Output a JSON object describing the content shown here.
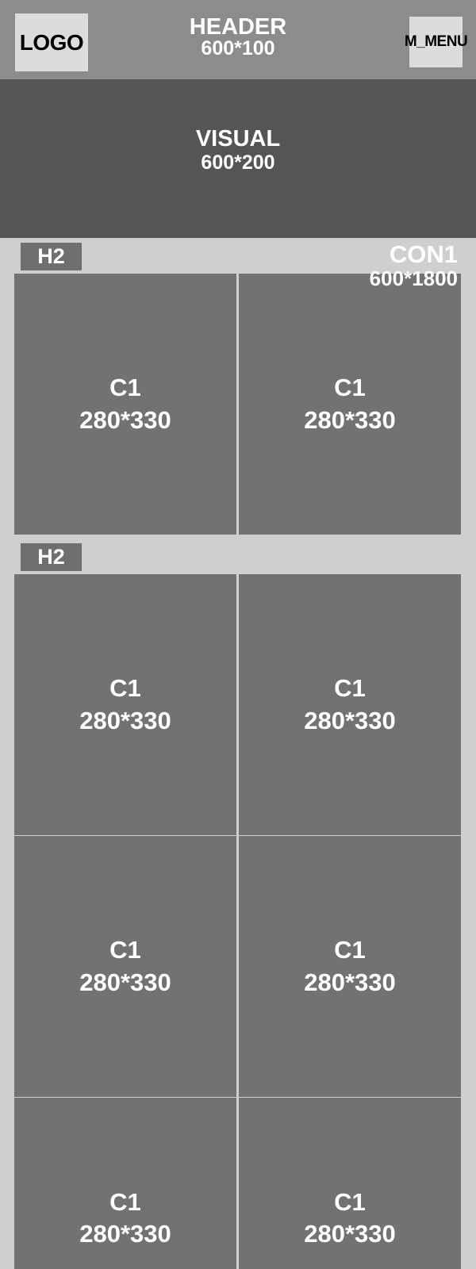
{
  "header": {
    "logo": "LOGO",
    "title": "HEADER",
    "size": "600*100",
    "menu": "M_MENU"
  },
  "visual": {
    "title": "VISUAL",
    "size": "600*200"
  },
  "con1": {
    "title": "CON1",
    "size": "600*1800"
  },
  "sections": [
    {
      "heading": "H2",
      "cards": [
        {
          "title": "C1",
          "size": "280*330"
        },
        {
          "title": "C1",
          "size": "280*330"
        }
      ]
    },
    {
      "heading": "H2",
      "cards": [
        {
          "title": "C1",
          "size": "280*330"
        },
        {
          "title": "C1",
          "size": "280*330"
        },
        {
          "title": "C1",
          "size": "280*330"
        },
        {
          "title": "C1",
          "size": "280*330"
        },
        {
          "title": "C1",
          "size": "280*330"
        },
        {
          "title": "C1",
          "size": "280*330"
        }
      ]
    }
  ]
}
